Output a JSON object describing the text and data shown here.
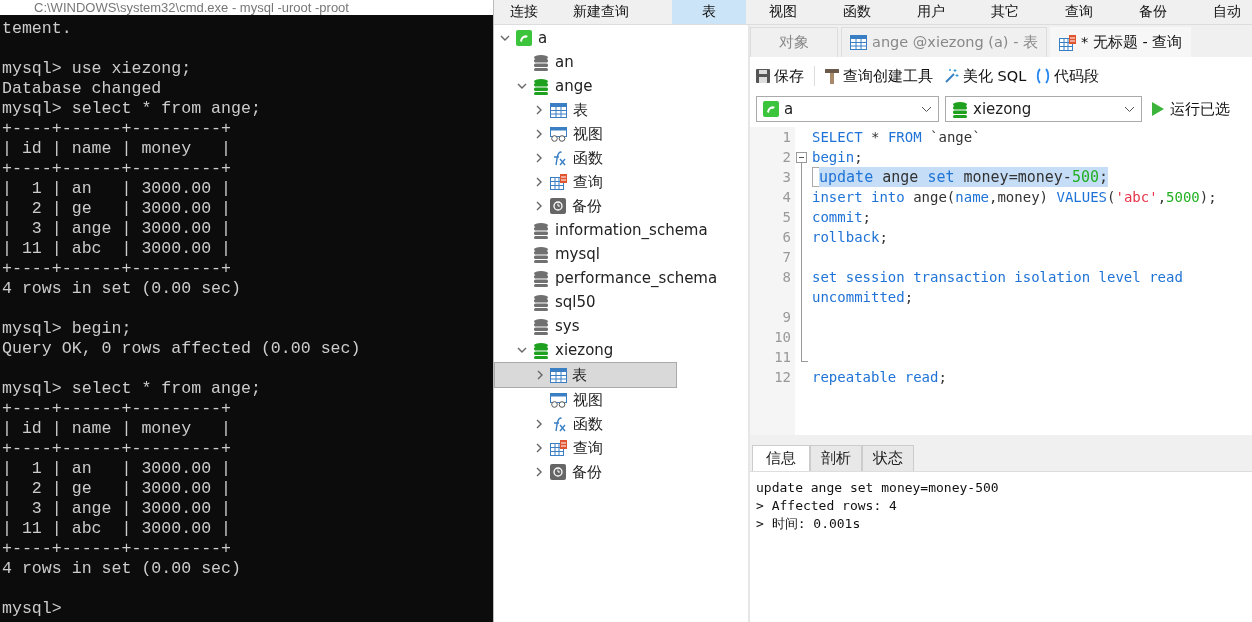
{
  "terminal": {
    "title": "C:\\WINDOWS\\system32\\cmd.exe - mysql -uroot -proot",
    "lines": [
      {
        "kind": "text",
        "text": "tement."
      },
      {
        "kind": "blank"
      },
      {
        "kind": "text",
        "text": "mysql> use xiezong;"
      },
      {
        "kind": "text",
        "text": "Database changed"
      },
      {
        "kind": "text",
        "text": "mysql> select * from ange;"
      },
      {
        "kind": "text",
        "text": "+----+------+---------+"
      },
      {
        "kind": "text",
        "text": "| id | name | money   |"
      },
      {
        "kind": "text",
        "text": "+----+------+---------+"
      },
      {
        "kind": "text",
        "text": "|  1 | an   | 3000.00 |"
      },
      {
        "kind": "text",
        "text": "|  2 | ge   | 3000.00 |"
      },
      {
        "kind": "text",
        "text": "|  3 | ange | 3000.00 |"
      },
      {
        "kind": "text",
        "text": "| 11 | abc  | 3000.00 |"
      },
      {
        "kind": "text",
        "text": "+----+------+---------+"
      },
      {
        "kind": "text",
        "text": "4 rows in set (0.00 sec)"
      },
      {
        "kind": "blank"
      },
      {
        "kind": "text",
        "text": "mysql> begin;"
      },
      {
        "kind": "text",
        "text": "Query OK, 0 rows affected (0.00 sec)"
      },
      {
        "kind": "blank"
      },
      {
        "kind": "text",
        "text": "mysql> select * from ange;"
      },
      {
        "kind": "text",
        "text": "+----+------+---------+"
      },
      {
        "kind": "text",
        "text": "| id | name | money   |"
      },
      {
        "kind": "text",
        "text": "+----+------+---------+"
      },
      {
        "kind": "text",
        "text": "|  1 | an   | 3000.00 |"
      },
      {
        "kind": "text",
        "text": "|  2 | ge   | 3000.00 |"
      },
      {
        "kind": "text",
        "text": "|  3 | ange | 3000.00 |"
      },
      {
        "kind": "text",
        "text": "| 11 | abc  | 3000.00 |"
      },
      {
        "kind": "text",
        "text": "+----+------+---------+"
      },
      {
        "kind": "text",
        "text": "4 rows in set (0.00 sec)"
      },
      {
        "kind": "blank"
      },
      {
        "kind": "text",
        "text": "mysql>"
      }
    ]
  },
  "menu_bar": [
    {
      "label": "连接",
      "selected": false
    },
    {
      "label": "新建查询",
      "selected": false
    },
    {
      "label": "表",
      "selected": true
    },
    {
      "label": "视图",
      "selected": false
    },
    {
      "label": "函数",
      "selected": false
    },
    {
      "label": "用户",
      "selected": false
    },
    {
      "label": "其它",
      "selected": false
    },
    {
      "label": "查询",
      "selected": false
    },
    {
      "label": "备份",
      "selected": false
    },
    {
      "label": "自动",
      "selected": false
    }
  ],
  "tree": [
    {
      "label": "a",
      "kind": "connection",
      "expanded": true,
      "selected": false,
      "children": [
        {
          "label": "an",
          "kind": "database",
          "selected": false
        },
        {
          "label": "ange",
          "kind": "database-open",
          "expanded": true,
          "selected": false,
          "children": [
            {
              "label": "表",
              "kind": "table",
              "expanded": false,
              "selected": false
            },
            {
              "label": "视图",
              "kind": "view",
              "expanded": false,
              "selected": false
            },
            {
              "label": "函数",
              "kind": "function",
              "expanded": false,
              "selected": false
            },
            {
              "label": "查询",
              "kind": "query",
              "expanded": false,
              "selected": false
            },
            {
              "label": "备份",
              "kind": "backup",
              "expanded": false,
              "selected": false
            }
          ]
        },
        {
          "label": "information_schema",
          "kind": "database",
          "selected": false
        },
        {
          "label": "mysql",
          "kind": "database",
          "selected": false
        },
        {
          "label": "performance_schema",
          "kind": "database",
          "selected": false
        },
        {
          "label": "sql50",
          "kind": "database",
          "selected": false
        },
        {
          "label": "sys",
          "kind": "database",
          "selected": false
        },
        {
          "label": "xiezong",
          "kind": "database-open",
          "expanded": true,
          "selected": false,
          "children": [
            {
              "label": "表",
              "kind": "table",
              "expanded": false,
              "selected": true
            },
            {
              "label": "视图",
              "kind": "view",
              "selected": false
            },
            {
              "label": "函数",
              "kind": "function",
              "expanded": false,
              "selected": false
            },
            {
              "label": "查询",
              "kind": "query",
              "expanded": false,
              "selected": false
            },
            {
              "label": "备份",
              "kind": "backup",
              "expanded": false,
              "selected": false
            }
          ]
        }
      ]
    }
  ],
  "editor_tabs": [
    {
      "label": "对象",
      "kind": "plain",
      "selected": false
    },
    {
      "label": "ange @xiezong (a) - 表",
      "kind": "table",
      "selected": false
    },
    {
      "label": "* 无标题 - 查询",
      "kind": "query",
      "selected": true
    }
  ],
  "toolbar": [
    {
      "label": "保存",
      "kind": "save"
    },
    {
      "label": "查询创建工具",
      "kind": "builder"
    },
    {
      "label": "美化 SQL",
      "kind": "beautify"
    },
    {
      "label": "代码段",
      "kind": "snippet"
    }
  ],
  "connection_select": {
    "value": "a"
  },
  "database_select": {
    "value": "xiezong"
  },
  "run_button": {
    "label": "运行已选"
  },
  "code": [
    {
      "number": "1",
      "rows": [
        [
          {
            "kind": "keyword",
            "text": "SELECT"
          },
          {
            "kind": "plain",
            "text": " * "
          },
          {
            "kind": "keyword",
            "text": "FROM"
          },
          {
            "kind": "plain",
            "text": " `ange`"
          }
        ]
      ],
      "selected": false
    },
    {
      "number": "2",
      "expanded": true,
      "rows": [
        [
          {
            "kind": "keyword",
            "text": "begin"
          },
          {
            "kind": "plain",
            "text": ";"
          }
        ]
      ],
      "selected": false,
      "children": [
        {
          "number": "3",
          "rows": [
            [
              {
                "kind": "keyword",
                "text": "update"
              },
              {
                "kind": "plain",
                "text": " ange "
              },
              {
                "kind": "keyword",
                "text": "set"
              },
              {
                "kind": "plain",
                "text": " money=money-"
              },
              {
                "kind": "number",
                "text": "500"
              },
              {
                "kind": "plain",
                "text": ";"
              }
            ]
          ],
          "selected": true
        },
        {
          "number": "4",
          "rows": [
            [
              {
                "kind": "keyword",
                "text": "insert into"
              },
              {
                "kind": "plain",
                "text": " ange("
              },
              {
                "kind": "keyword",
                "text": "name"
              },
              {
                "kind": "plain",
                "text": ",money) "
              },
              {
                "kind": "keyword",
                "text": "VALUES"
              },
              {
                "kind": "plain",
                "text": "("
              },
              {
                "kind": "string",
                "text": "'abc'"
              },
              {
                "kind": "plain",
                "text": ","
              },
              {
                "kind": "number",
                "text": "5000"
              },
              {
                "kind": "plain",
                "text": ");"
              }
            ]
          ],
          "selected": false
        },
        {
          "number": "5",
          "rows": [
            [
              {
                "kind": "keyword",
                "text": "commit"
              },
              {
                "kind": "plain",
                "text": ";"
              }
            ]
          ],
          "selected": false
        },
        {
          "number": "6",
          "rows": [
            [
              {
                "kind": "keyword",
                "text": "rollback"
              },
              {
                "kind": "plain",
                "text": ";"
              }
            ]
          ],
          "selected": false
        },
        {
          "number": "7",
          "rows": [
            []
          ],
          "selected": false
        },
        {
          "number": "8",
          "rows": [
            [
              {
                "kind": "keyword",
                "text": "set session transaction isolation level read"
              }
            ],
            [
              {
                "kind": "keyword",
                "text": "uncommitted"
              },
              {
                "kind": "plain",
                "text": ";"
              }
            ]
          ],
          "selected": false
        },
        {
          "number": "9",
          "rows": [
            []
          ],
          "selected": false
        },
        {
          "number": "10",
          "rows": [
            []
          ],
          "selected": false
        },
        {
          "number": "11",
          "rows": [
            []
          ],
          "selected": false
        }
      ]
    },
    {
      "number": "12",
      "rows": [
        [
          {
            "kind": "keyword",
            "text": "repeatable read"
          },
          {
            "kind": "plain",
            "text": ";"
          }
        ]
      ],
      "selected": false
    }
  ],
  "result_tabs": [
    {
      "label": "信息",
      "selected": true
    },
    {
      "label": "剖析",
      "selected": false
    },
    {
      "label": "状态",
      "selected": false
    }
  ],
  "messages": [
    "update ange set money=money-500",
    "> Affected rows: 4",
    "> 时间: 0.001s"
  ]
}
